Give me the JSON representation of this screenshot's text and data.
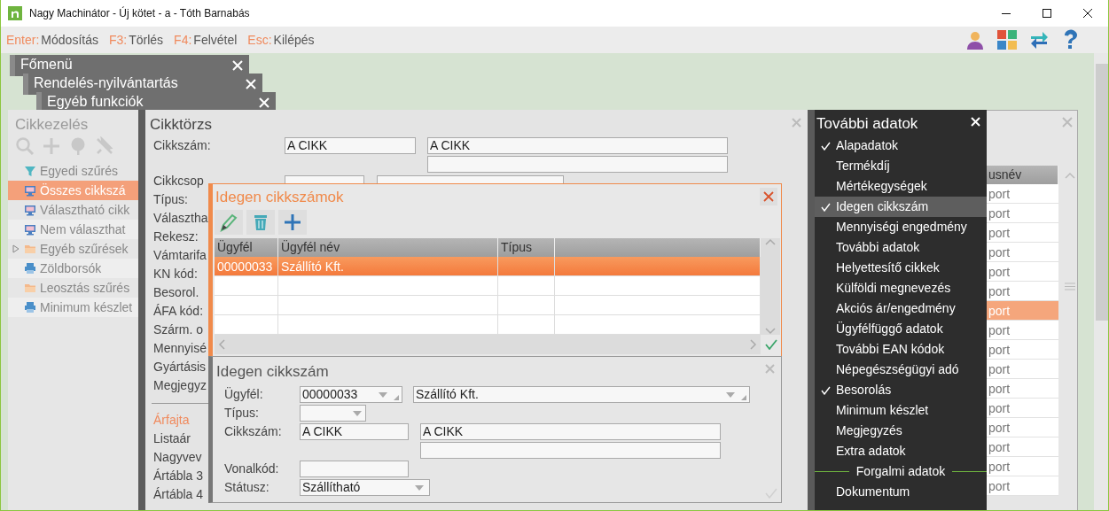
{
  "window": {
    "title": "Nagy Machinátor - Új kötet - a - Tóth Barnabás"
  },
  "shortcuts": [
    {
      "key": "Enter:",
      "label": "Módosítás"
    },
    {
      "key": "F3:",
      "label": "Törlés"
    },
    {
      "key": "F4:",
      "label": "Felvétel"
    },
    {
      "key": "Esc:",
      "label": "Kilépés"
    }
  ],
  "window_tabs": [
    {
      "label": "Főmenü"
    },
    {
      "label": "Rendelés-nyilvántartás"
    },
    {
      "label": "Egyéb funkciók"
    }
  ],
  "side_panel": {
    "title": "Cikkezelés",
    "items": [
      {
        "label": "Egyedi szűrés",
        "kind": "filter",
        "selected": false
      },
      {
        "label": "Összes cikkszá",
        "kind": "screen",
        "selected": true
      },
      {
        "label": "Választható cikk",
        "kind": "screen",
        "selected": false
      },
      {
        "label": "Nem választhat",
        "kind": "screen",
        "selected": false
      },
      {
        "label": "Egyéb szűrések",
        "kind": "group",
        "selected": false
      },
      {
        "label": "Zöldborsók",
        "kind": "printer",
        "selected": false
      },
      {
        "label": "Leosztás szűrés",
        "kind": "folder",
        "selected": false
      },
      {
        "label": "Minimum készlet",
        "kind": "printer",
        "selected": false
      }
    ]
  },
  "article_form": {
    "title": "Cikktörzs",
    "code_label": "Cikkszám:",
    "code": "A CIKK",
    "name": "A CIKK",
    "labels": [
      "Cikkcsop",
      "Típus:",
      "Választha",
      "Rekesz:",
      "Vámtarifa",
      "KN kód:",
      "Besorol.",
      "ÁFA kód:",
      "Szárm. o",
      "Mennyisé",
      "Gyártásis",
      "Megjegyz"
    ],
    "price_heading": "Árfajta",
    "price_labels": [
      "Listaár",
      "Nagyvev",
      "Ártábla 3",
      "Ártábla 4"
    ]
  },
  "foreign_codes_dialog": {
    "title": "Idegen cikkszámok",
    "columns": [
      "Ügyfél",
      "Ügyfél név",
      "Típus"
    ],
    "rows": [
      {
        "cells": [
          "00000033",
          "Szállító Kft."
        ],
        "selected": true
      }
    ]
  },
  "edit_dialog": {
    "title": "Idegen cikkszám",
    "fields": [
      {
        "label": "Ügyfél:",
        "kind": "customer",
        "value": "00000033",
        "name": "Szállító Kft."
      },
      {
        "label": "Típus:",
        "kind": "type"
      },
      {
        "label": "Cikkszám:",
        "kind": "code",
        "value": "A CIKK",
        "name": "A CIKK"
      },
      {
        "label": "Vonalkód:",
        "kind": "text"
      },
      {
        "label": "Státusz:",
        "kind": "status",
        "value": "Szállítható"
      }
    ]
  },
  "more_data_menu": {
    "title": "További adatok",
    "items": [
      {
        "label": "Alapadatok",
        "kind": "item",
        "checked": true,
        "selected": false
      },
      {
        "label": "Termékdíj",
        "kind": "item",
        "checked": false,
        "selected": false
      },
      {
        "label": "Mértékegységek",
        "kind": "item",
        "checked": false,
        "selected": false
      },
      {
        "label": "Idegen cikkszám",
        "kind": "item",
        "checked": true,
        "selected": true
      },
      {
        "label": "Mennyiségi engedmény",
        "kind": "item",
        "checked": false,
        "selected": false
      },
      {
        "label": "További adatok",
        "kind": "item",
        "checked": false,
        "selected": false
      },
      {
        "label": "Helyettesítő cikkek",
        "kind": "item",
        "checked": false,
        "selected": false
      },
      {
        "label": "Külföldi megnevezés",
        "kind": "item",
        "checked": false,
        "selected": false
      },
      {
        "label": "Akciós ár/engedmény",
        "kind": "item",
        "checked": false,
        "selected": false
      },
      {
        "label": "Ügyfélfüggő adatok",
        "kind": "item",
        "checked": false,
        "selected": false
      },
      {
        "label": "További EAN kódok",
        "kind": "item",
        "checked": false,
        "selected": false
      },
      {
        "label": "Népegészségügyi adó",
        "kind": "item",
        "checked": false,
        "selected": false
      },
      {
        "label": "Besorolás",
        "kind": "item",
        "checked": true,
        "selected": false
      },
      {
        "label": "Minimum készlet",
        "kind": "item",
        "checked": false,
        "selected": false
      },
      {
        "label": "Megjegyzés",
        "kind": "item",
        "checked": false,
        "selected": false
      },
      {
        "label": "Extra adatok",
        "kind": "item",
        "checked": false,
        "selected": false
      },
      {
        "label": "Forgalmi adatok",
        "kind": "section"
      },
      {
        "label": "Dokumentum",
        "kind": "item",
        "checked": false,
        "selected": false
      }
    ]
  },
  "list_window": {
    "column": "usnév",
    "rows": [
      {
        "cell": "port",
        "selected": false
      },
      {
        "cell": "port",
        "selected": false
      },
      {
        "cell": "port",
        "selected": false
      },
      {
        "cell": "port",
        "selected": false
      },
      {
        "cell": "port",
        "selected": false
      },
      {
        "cell": "port",
        "selected": false
      },
      {
        "cell": "port",
        "selected": true
      },
      {
        "cell": "port",
        "selected": false
      },
      {
        "cell": "port",
        "selected": false
      },
      {
        "cell": "port",
        "selected": false
      },
      {
        "cell": "port",
        "selected": false
      },
      {
        "cell": "port",
        "selected": false
      },
      {
        "cell": "port",
        "selected": false
      },
      {
        "cell": "port",
        "selected": false
      },
      {
        "cell": "port",
        "selected": false
      },
      {
        "cell": "port",
        "selected": false
      }
    ]
  }
}
